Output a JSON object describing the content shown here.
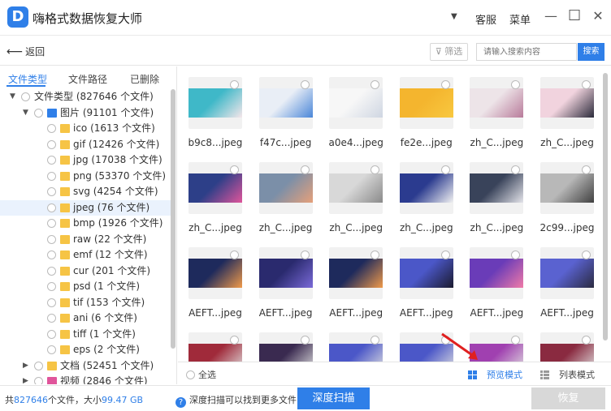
{
  "app": {
    "title": "嗨格式数据恢复大师",
    "logo_letter": "D"
  },
  "titlebar": {
    "service": "客服",
    "menu": "菜单",
    "minimize": "—",
    "maximize": "☐",
    "close": "✕"
  },
  "toolbar": {
    "back_label": "返回",
    "filter_label": "筛选",
    "search_placeholder": "请输入搜索内容",
    "search_button": "搜索"
  },
  "sidebar": {
    "tabs": [
      "文件类型",
      "文件路径",
      "已删除"
    ],
    "tree": [
      {
        "label": "文件类型 (827646 个文件)",
        "level": 0,
        "expander": "▼",
        "icon": "none"
      },
      {
        "label": "图片 (91101 个文件)",
        "level": 1,
        "expander": "▼",
        "icon": "image"
      },
      {
        "label": "ico (1613 个文件)",
        "level": 2,
        "icon": "folder"
      },
      {
        "label": "gif (12426 个文件)",
        "level": 2,
        "icon": "folder"
      },
      {
        "label": "jpg (17038 个文件)",
        "level": 2,
        "icon": "folder"
      },
      {
        "label": "png (53370 个文件)",
        "level": 2,
        "icon": "folder"
      },
      {
        "label": "svg (4254 个文件)",
        "level": 2,
        "icon": "folder"
      },
      {
        "label": "jpeg (76 个文件)",
        "level": 2,
        "icon": "folder",
        "selected": true
      },
      {
        "label": "bmp (1926 个文件)",
        "level": 2,
        "icon": "folder"
      },
      {
        "label": "raw (22 个文件)",
        "level": 2,
        "icon": "folder"
      },
      {
        "label": "emf (12 个文件)",
        "level": 2,
        "icon": "folder"
      },
      {
        "label": "cur (201 个文件)",
        "level": 2,
        "icon": "folder"
      },
      {
        "label": "psd (1 个文件)",
        "level": 2,
        "icon": "folder"
      },
      {
        "label": "tif (153 个文件)",
        "level": 2,
        "icon": "folder"
      },
      {
        "label": "ani (6 个文件)",
        "level": 2,
        "icon": "folder"
      },
      {
        "label": "tiff (1 个文件)",
        "level": 2,
        "icon": "folder"
      },
      {
        "label": "eps (2 个文件)",
        "level": 2,
        "icon": "folder"
      },
      {
        "label": "文档 (52451 个文件)",
        "level": 1,
        "expander": "▶",
        "icon": "doc"
      },
      {
        "label": "视频 (2846 个文件)",
        "level": 1,
        "expander": "▶",
        "icon": "video"
      }
    ]
  },
  "files": [
    {
      "name": "b9c8...jpeg",
      "colors": [
        "#3fb8c8",
        "#f5e6ea"
      ]
    },
    {
      "name": "f47c...jpeg",
      "colors": [
        "#e9eef6",
        "#4a86d8"
      ]
    },
    {
      "name": "a0e4...jpeg",
      "colors": [
        "#f7f7f7",
        "#cfd6e2"
      ]
    },
    {
      "name": "fe2e...jpeg",
      "colors": [
        "#f4b52e",
        "#f8c840"
      ]
    },
    {
      "name": "zh_C...jpeg",
      "colors": [
        "#ede4e8",
        "#b87b9a"
      ]
    },
    {
      "name": "zh_C...jpeg",
      "colors": [
        "#f1d3de",
        "#2a2a3a"
      ]
    },
    {
      "name": "zh_C...jpeg",
      "colors": [
        "#2d3f88",
        "#e0559b"
      ]
    },
    {
      "name": "zh_C...jpeg",
      "colors": [
        "#7b8fa8",
        "#e6a07a"
      ]
    },
    {
      "name": "zh_C...jpeg",
      "colors": [
        "#d8d8d8",
        "#8a8a8a"
      ]
    },
    {
      "name": "zh_C...jpeg",
      "colors": [
        "#2b3b8f",
        "#f2f2f2"
      ]
    },
    {
      "name": "zh_C...jpeg",
      "colors": [
        "#39435a",
        "#e4e4ea"
      ]
    },
    {
      "name": "2c99...jpeg",
      "colors": [
        "#b8b8b8",
        "#404040"
      ]
    },
    {
      "name": "AEFT...jpeg",
      "colors": [
        "#1e2a5c",
        "#f09a4a"
      ]
    },
    {
      "name": "AEFT...jpeg",
      "colors": [
        "#2a2a6e",
        "#7a6ad8"
      ]
    },
    {
      "name": "AEFT...jpeg",
      "colors": [
        "#1e2a5c",
        "#f09a4a"
      ]
    },
    {
      "name": "AEFT...jpeg",
      "colors": [
        "#4b57c8",
        "#1a1a2e"
      ]
    },
    {
      "name": "AEFT...jpeg",
      "colors": [
        "#6a3cb8",
        "#f07aa8"
      ]
    },
    {
      "name": "AEFT...jpeg",
      "colors": [
        "#5a62d0",
        "#2a2a40"
      ]
    },
    {
      "name": "",
      "colors": [
        "#a02a3a",
        "#e0e0e0"
      ]
    },
    {
      "name": "",
      "colors": [
        "#3a2a50",
        "#e0e0e0"
      ]
    },
    {
      "name": "",
      "colors": [
        "#4b57c8",
        "#e0e0e0"
      ]
    },
    {
      "name": "",
      "colors": [
        "#4b57c8",
        "#e0e0e0"
      ]
    },
    {
      "name": "",
      "colors": [
        "#a040b0",
        "#e0e0e0"
      ]
    },
    {
      "name": "",
      "colors": [
        "#8a2a40",
        "#e0e0e0"
      ]
    }
  ],
  "bottom": {
    "select_all": "全选",
    "preview_mode": "预览模式",
    "list_mode": "列表模式"
  },
  "footer": {
    "prefix": "共",
    "total": "827646",
    "mid": "个文件，大小",
    "size": "99.47 GB",
    "tip": "深度扫描可以找到更多文件",
    "deep_scan": "深度扫描",
    "recover": "恢复"
  },
  "colors": {
    "accent": "#2f7fe8",
    "folder": "#f6c445",
    "annotation_arrow": "#e02020"
  }
}
